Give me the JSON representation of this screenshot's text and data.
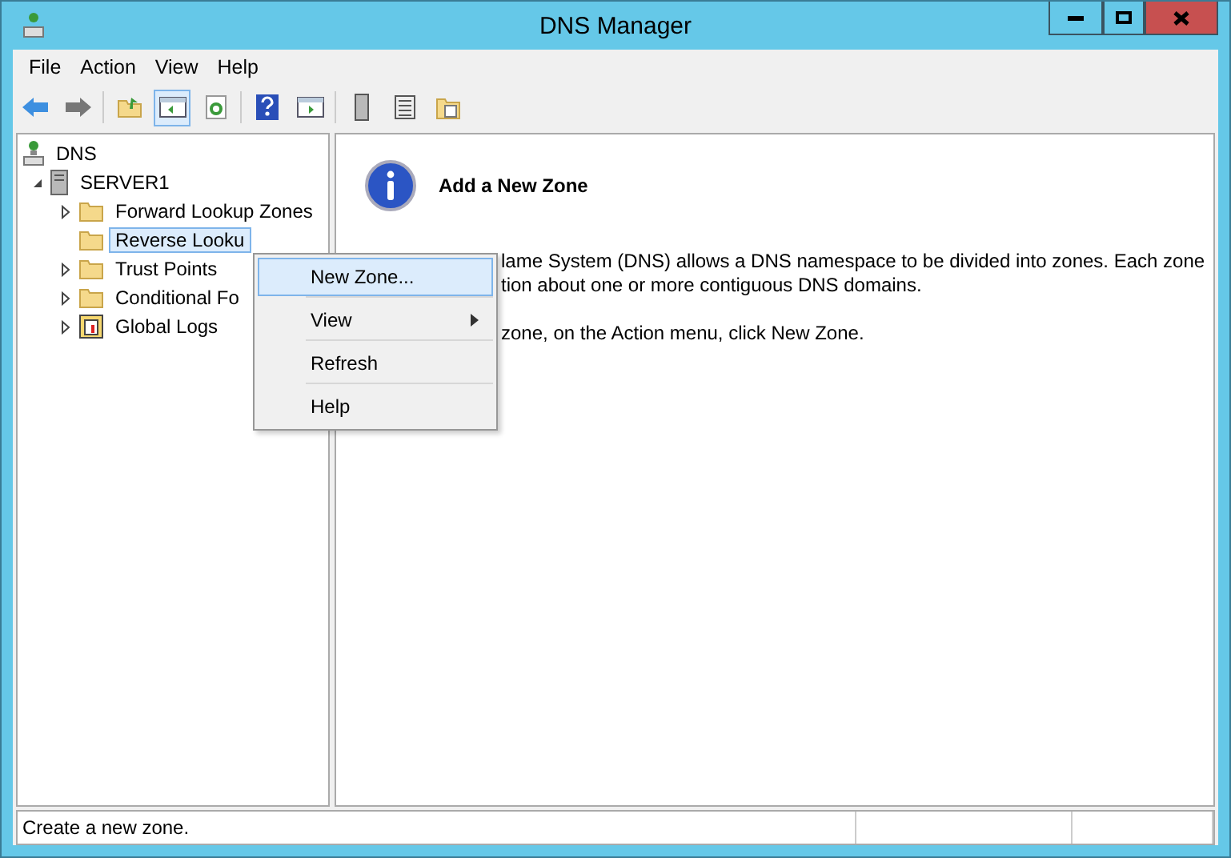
{
  "window": {
    "title": "DNS Manager"
  },
  "menu_bar": [
    "File",
    "Action",
    "View",
    "Help"
  ],
  "tree": [
    {
      "label": "DNS",
      "kind": "dns",
      "selected": false,
      "children": [
        {
          "label": "SERVER1",
          "kind": "server",
          "expanded": true,
          "selected": false,
          "children": [
            {
              "label": "Forward Lookup Zones",
              "kind": "folder",
              "expanded": false,
              "selected": false
            },
            {
              "label": "Reverse Looku",
              "kind": "folder",
              "selected": true
            },
            {
              "label": "Trust Points",
              "kind": "folder",
              "expanded": false,
              "selected": false
            },
            {
              "label": "Conditional Fo",
              "kind": "folder",
              "expanded": false,
              "selected": false
            },
            {
              "label": "Global Logs",
              "kind": "log",
              "expanded": false,
              "selected": false
            }
          ]
        }
      ]
    }
  ],
  "context_menu": [
    {
      "label": "New Zone...",
      "kind": "item",
      "selected": true
    },
    {
      "label": "View",
      "kind": "submenu",
      "selected": false
    },
    {
      "label": "Refresh",
      "kind": "item",
      "selected": false
    },
    {
      "label": "Help",
      "kind": "item",
      "selected": false
    }
  ],
  "content": {
    "heading": "Add a New Zone",
    "paragraphs": [
      [
        "lame System (DNS) allows a DNS namespace to be divided into zones. Each zone",
        "tion about one or more contiguous DNS domains."
      ],
      [
        "zone, on the Action menu, click New Zone."
      ]
    ]
  },
  "status_bar": [
    "Create a new zone."
  ]
}
